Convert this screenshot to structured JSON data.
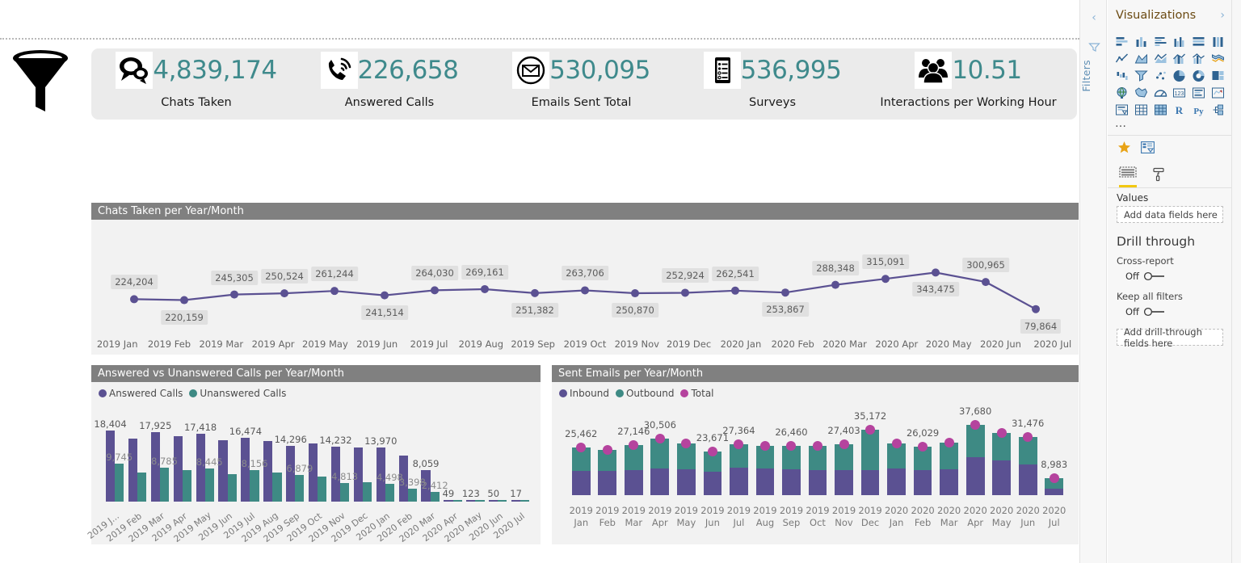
{
  "kpi_panel": {
    "items": [
      {
        "icon": "chat-bubbles-icon",
        "value": "4,839,174",
        "label": "Chats Taken"
      },
      {
        "icon": "phone-ringing-icon",
        "value": "226,658",
        "label": "Answered Calls"
      },
      {
        "icon": "envelope-circle-icon",
        "value": "530,095",
        "label": "Emails Sent Total"
      },
      {
        "icon": "survey-clipboard-icon",
        "value": "536,995",
        "label": "Surveys"
      },
      {
        "icon": "people-group-icon",
        "value": "10.51",
        "label": "Interactions per Working Hour"
      }
    ]
  },
  "colors": {
    "purple": "#5B5192",
    "teal": "#3E8A84",
    "magenta": "#B5439E",
    "kpi_value": "#3f8a8c",
    "header_bar": "#808080",
    "accent_yellow": "#f2c811"
  },
  "chart_data": [
    {
      "id": "chats",
      "type": "line",
      "title": "Chats Taken per Year/Month",
      "xlabel": "",
      "ylabel": "",
      "grid": false,
      "legend": "none",
      "categories": [
        "2019 Jan",
        "2019 Feb",
        "2019 Mar",
        "2019 Apr",
        "2019 May",
        "2019 Jun",
        "2019 Jul",
        "2019 Aug",
        "2019 Sep",
        "2019 Oct",
        "2019 Nov",
        "2019 Dec",
        "2020 Jan",
        "2020 Feb",
        "2020 Mar",
        "2020 Apr",
        "2020 May",
        "2020 Jun",
        "2020 Jul"
      ],
      "values": [
        224204,
        220159,
        245305,
        250524,
        261244,
        241514,
        264030,
        269161,
        251382,
        263706,
        250870,
        252924,
        262541,
        253867,
        288348,
        315091,
        343475,
        300965,
        179864
      ],
      "labels": [
        "224,204",
        "220,159",
        "245,305",
        "250,524",
        "261,244",
        "241,514",
        "264,030",
        "269,161",
        "251,382",
        "263,706",
        "250,870",
        "252,924",
        "262,541",
        "253,867",
        "288,348",
        "315,091",
        "343,475",
        "300,965",
        "79,864"
      ],
      "label_side": [
        "above",
        "below",
        "above",
        "above",
        "above",
        "below",
        "above",
        "above",
        "below",
        "above",
        "below",
        "above",
        "above",
        "below",
        "above",
        "above",
        "below",
        "above",
        "below"
      ],
      "ylim": [
        150000,
        370000
      ]
    },
    {
      "id": "calls",
      "type": "bar",
      "title": "Answered vs Unanswered Calls per Year/Month",
      "xlabel": "",
      "ylabel": "",
      "grid": false,
      "legend": "top-left",
      "categories": [
        "2019 J...",
        "2019 Feb",
        "2019 Mar",
        "2019 Apr",
        "2019 May",
        "2019 Jun",
        "2019 Jul",
        "2019 Aug",
        "2019 Sep",
        "2019 Oct",
        "2019 Nov",
        "2019 Dec",
        "2020 Jan",
        "2020 Feb",
        "2020 Mar",
        "2020 Apr",
        "2020 May",
        "2020 Jun",
        "2020 Jul"
      ],
      "series": [
        {
          "name": "Answered Calls",
          "color": "#5B5192",
          "values": [
            18404,
            16200,
            17925,
            16900,
            17418,
            15900,
            16474,
            15700,
            14296,
            14900,
            14232,
            14050,
            13970,
            11800,
            8059,
            49,
            123,
            50,
            17
          ],
          "labels": [
            "18,404",
            "",
            "17,925",
            "",
            "17,418",
            "",
            "16,474",
            "",
            "14,296",
            "",
            "14,232",
            "",
            "13,970",
            "",
            "8,059",
            "49",
            "123",
            "50",
            "17"
          ]
        },
        {
          "name": "Unanswered Calls",
          "color": "#3E8A84",
          "values": [
            9745,
            7600,
            8785,
            8100,
            8445,
            7000,
            8156,
            7450,
            6879,
            6400,
            4813,
            5100,
            4498,
            3398,
            2412,
            20,
            30,
            20,
            10
          ],
          "labels": [
            "9,745",
            "",
            "8,785",
            "",
            "8,445",
            "",
            "8,156",
            "",
            "6,879",
            "",
            "4,813",
            "",
            "4,498",
            "3,398",
            "2,412",
            "",
            "",
            "",
            ""
          ]
        }
      ],
      "ylim": [
        0,
        20000
      ]
    },
    {
      "id": "emails",
      "type": "bar",
      "title": "Sent Emails per Year/Month",
      "xlabel": "",
      "ylabel": "",
      "grid": false,
      "stacked": true,
      "legend": "top-left",
      "categories": [
        "2019 Jan",
        "2019 Feb",
        "2019 Mar",
        "2019 Apr",
        "2019 May",
        "2019 Jun",
        "2019 Jul",
        "2019 Aug",
        "2019 Sep",
        "2019 Oct",
        "2019 Nov",
        "2019 Dec",
        "2020 Jan",
        "2020 Feb",
        "2020 Mar",
        "2020 Apr",
        "2020 May",
        "2020 Jun",
        "2020 Jul"
      ],
      "cat_lines": [
        [
          "2019",
          "Jan"
        ],
        [
          "2019",
          "Feb"
        ],
        [
          "2019",
          "Mar"
        ],
        [
          "2019",
          "Apr"
        ],
        [
          "2019",
          "May"
        ],
        [
          "2019",
          "Jun"
        ],
        [
          "2019",
          "Jul"
        ],
        [
          "2019",
          "Aug"
        ],
        [
          "2019",
          "Sep"
        ],
        [
          "2019",
          "Oct"
        ],
        [
          "2019",
          "Nov"
        ],
        [
          "2019",
          "Dec"
        ],
        [
          "2020",
          "Jan"
        ],
        [
          "2020",
          "Feb"
        ],
        [
          "2020",
          "Mar"
        ],
        [
          "2020",
          "Apr"
        ],
        [
          "2020",
          "May"
        ],
        [
          "2020",
          "Jun"
        ],
        [
          "2020",
          "Jul"
        ]
      ],
      "series": [
        {
          "name": "Inbound",
          "color": "#5B5192",
          "values": [
            13200,
            12900,
            13300,
            14300,
            13900,
            12500,
            14600,
            14200,
            13800,
            13600,
            13300,
            13500,
            14200,
            13300,
            13900,
            20500,
            18700,
            16500,
            3600
          ]
        },
        {
          "name": "Outbound",
          "color": "#3E8A84",
          "values": [
            12262,
            11400,
            13846,
            16206,
            14000,
            11171,
            12764,
            12260,
            12660,
            12900,
            14103,
            21672,
            13800,
            12729,
            14200,
            17180,
            14600,
            14976,
            5383
          ]
        },
        {
          "name": "Total",
          "color": "#B5439E",
          "values": [
            25462,
            24300,
            27146,
            30506,
            27900,
            23671,
            27364,
            26460,
            26460,
            26500,
            27403,
            35172,
            28000,
            26029,
            28100,
            37680,
            33300,
            31476,
            8983
          ],
          "labels": [
            "25,462",
            "",
            "27,146",
            "30,506",
            "",
            "23,671",
            "27,364",
            "",
            "26,460",
            "",
            "27,403",
            "35,172",
            "",
            "26,029",
            "",
            "37,680",
            "",
            "31,476",
            "8,983"
          ]
        }
      ],
      "ylim": [
        0,
        40000
      ]
    }
  ],
  "filters_pane": {
    "collapse_label": "‹",
    "funnel_icon": "filter-funnel-icon",
    "title": "Filters"
  },
  "visualizations_pane": {
    "title": "Visualizations",
    "expand_chevron": "›",
    "icon_names": [
      "stacked-bar-chart-icon",
      "stacked-column-chart-icon",
      "clustered-bar-chart-icon",
      "clustered-column-chart-icon",
      "hundred-percent-stacked-bar-icon",
      "hundred-percent-stacked-column-icon",
      "line-chart-icon",
      "area-chart-icon",
      "stacked-area-chart-icon",
      "line-stacked-column-icon",
      "line-clustered-column-icon",
      "ribbon-chart-icon",
      "waterfall-chart-icon",
      "funnel-chart-icon",
      "scatter-chart-icon",
      "pie-chart-icon",
      "donut-chart-icon",
      "treemap-icon",
      "map-icon",
      "filled-map-icon",
      "gauge-icon",
      "card-icon",
      "multi-row-card-icon",
      "kpi-icon",
      "slicer-icon",
      "table-icon",
      "matrix-icon",
      "r-script-visual-icon",
      "python-visual-icon",
      "get-more-visuals-icon"
    ],
    "more_options": "…",
    "favorite_icon": "star-icon",
    "visual_type_icon": "visual-type-icon",
    "tabs": [
      {
        "name": "fields-tab",
        "icon": "fields-pane-icon",
        "active": true
      },
      {
        "name": "format-tab",
        "icon": "paint-roller-icon",
        "active": false
      }
    ],
    "values_label": "Values",
    "values_placeholder": "Add data fields here",
    "drill_through": {
      "title": "Drill through",
      "cross_report_label": "Cross-report",
      "cross_report_state": "Off",
      "keep_all_filters_label": "Keep all filters",
      "keep_all_filters_state": "Off",
      "placeholder": "Add drill-through fields here"
    }
  }
}
